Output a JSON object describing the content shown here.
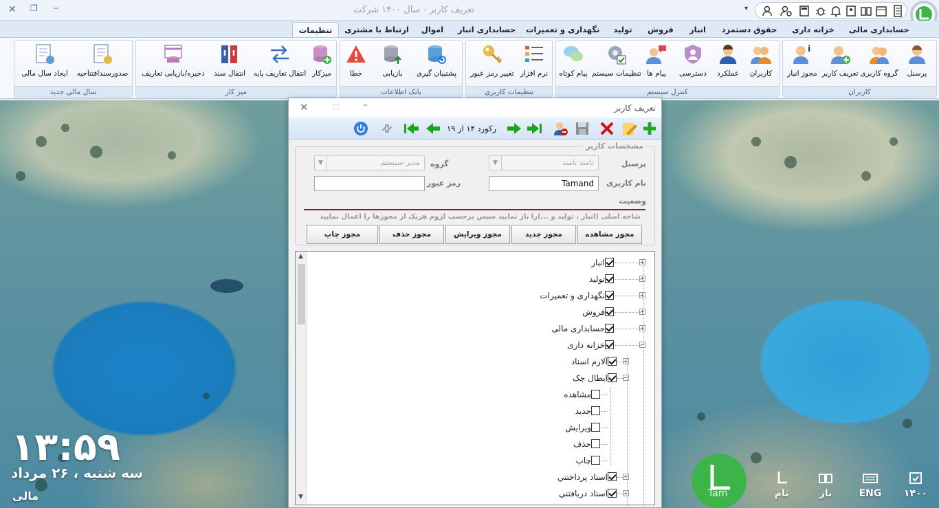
{
  "window": {
    "title": "تعریف کاربر - سال ۱۴۰۰ شرکت"
  },
  "tabs": [
    "حسابداری مالی",
    "خزانه داری",
    "حقوق دستمزد",
    "انبار",
    "فروش",
    "تولید",
    "نگهداری و تعمیرات",
    "حسابداری انبار",
    "اموال",
    "ارتباط با مشتری",
    "تنظیمات"
  ],
  "groups": {
    "users": "کاربران",
    "system": "کنترل سیستم",
    "user_settings": "تنظیمات کاربری",
    "database": "بانک اطلاعات",
    "desk": "میز کار",
    "fiscal": "سال مالی جدید"
  },
  "buttons": {
    "personnel": "پرسنل",
    "user_group": "گروه کاربری",
    "define_user": "تعریف کاربر",
    "warehouse_perm": "مجوز انبار",
    "users": "کاربران",
    "performance": "عملکرد",
    "access": "دسترسی",
    "messages": "پیام ها",
    "system_settings": "تنظیمات سیستم",
    "short_message": "پیام کوتاه",
    "software": "نرم افزار",
    "change_password": "تغییر رمز عبور",
    "backup": "پشتیبان گیری",
    "restore": "بازیابی",
    "error": "خطا",
    "desk": "میزکار",
    "transfer_base": "انتقال تعاریف پایه",
    "transfer_doc": "انتقال سند",
    "save_restore_defs": "ذخیره/بازیابی تعاریف",
    "issue_opening": "صدورسندافتتاحیه",
    "create_fiscal": "ایجاد سال مالی"
  },
  "dialog": {
    "title": "تعریف کاربر",
    "record": "رکورد ۱۴ از ۱۹",
    "fieldset": "مشخصات کاربر",
    "personnel_label": "پرسنل",
    "personnel_value": "تامند تامند",
    "group_label": "گروه",
    "group_value": "مدیر سیستم",
    "username_label": "نام کاربری",
    "username_value": "Tamand",
    "password_label": "رمز عبور",
    "status_label": "وضعیت",
    "hint": "شاخه اصلی (انبار ، تولید و ...)را باز نمایید سپس برحسب لزوم هریک از مجوزها را اعمال نمایید",
    "perm_buttons": [
      "مجوز مشاهده",
      "مجوز جدید",
      "مجوز ویرایش",
      "مجوز حذف",
      "مجوز چاپ"
    ]
  },
  "tree": [
    {
      "label": "انبار",
      "checked": true,
      "level": 0,
      "exp": "+"
    },
    {
      "label": "تولید",
      "checked": true,
      "level": 0,
      "exp": "+"
    },
    {
      "label": "نگهداری و تعمیرات",
      "checked": true,
      "level": 0,
      "exp": "+"
    },
    {
      "label": "فروش",
      "checked": true,
      "level": 0,
      "exp": "+"
    },
    {
      "label": "حسابداری مالی",
      "checked": true,
      "level": 0,
      "exp": "+"
    },
    {
      "label": "خزانه داری",
      "checked": true,
      "level": 0,
      "exp": "-"
    },
    {
      "label": "آلارم اسناد",
      "checked": true,
      "level": 1,
      "exp": "+"
    },
    {
      "label": "ابطال چک",
      "checked": true,
      "level": 1,
      "exp": "-"
    },
    {
      "label": "مشاهده",
      "checked": false,
      "level": 2,
      "exp": ""
    },
    {
      "label": "جدید",
      "checked": false,
      "level": 2,
      "exp": ""
    },
    {
      "label": "ویرایش",
      "checked": false,
      "level": 2,
      "exp": ""
    },
    {
      "label": "حذف",
      "checked": false,
      "level": 2,
      "exp": ""
    },
    {
      "label": "چاپ",
      "checked": false,
      "level": 2,
      "exp": ""
    },
    {
      "label": "اسناد پرداختني",
      "checked": true,
      "level": 1,
      "exp": "+"
    },
    {
      "label": "اسناد دريافتني",
      "checked": true,
      "level": 1,
      "exp": "+"
    }
  ],
  "desktop": {
    "time": "۱۳:۵۹",
    "date": "سه شنبه ، ۲۶ مرداد",
    "module": "مالی",
    "user_badge": "Tam",
    "tray_user": "تام",
    "tray_open": "باز",
    "tray_lang": "ENG",
    "tray_year": "۱۴۰۰"
  },
  "colors": {
    "accent": "#2f7de1",
    "add": "#1faa1f",
    "delete": "#d01010",
    "nav": "#1aa51a"
  }
}
